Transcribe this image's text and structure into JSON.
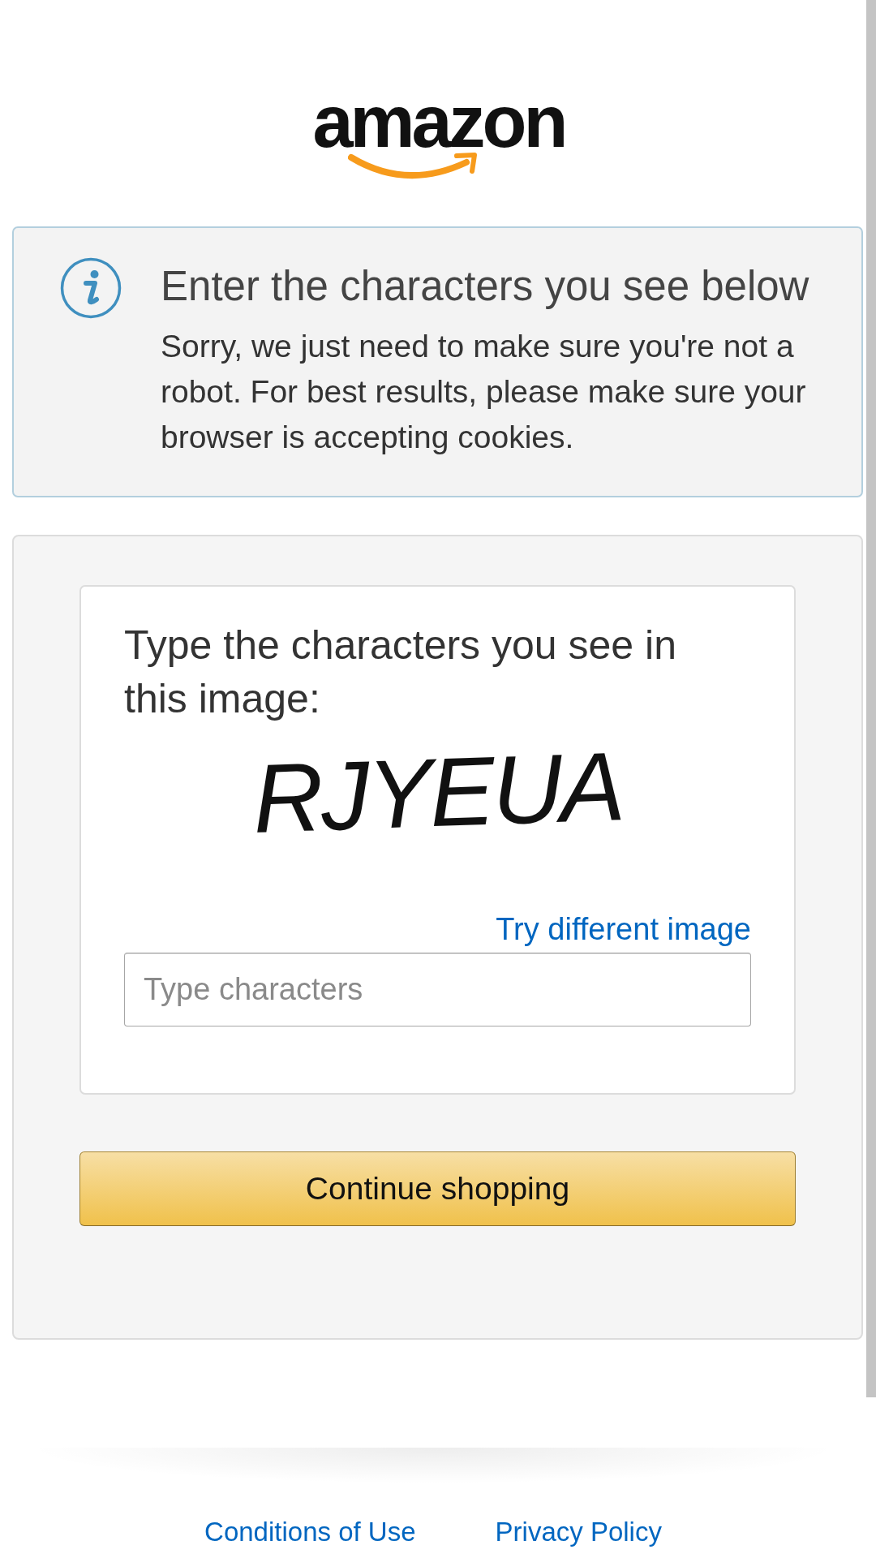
{
  "logo": {
    "text": "amazon"
  },
  "alert": {
    "kind": "info",
    "title": "Enter the characters you see below",
    "message": "Sorry, we just need to make sure you're not a robot. For best results, please make sure your browser is accepting cookies."
  },
  "captcha": {
    "prompt": "Type the characters you see in this image:",
    "image_text": "RJYEUA",
    "refresh_link": "Try different image",
    "input": {
      "placeholder": "Type characters"
    }
  },
  "submit_button": {
    "label": "Continue shopping"
  },
  "footer": {
    "links": [
      "Conditions of Use",
      "Privacy Policy"
    ]
  }
}
